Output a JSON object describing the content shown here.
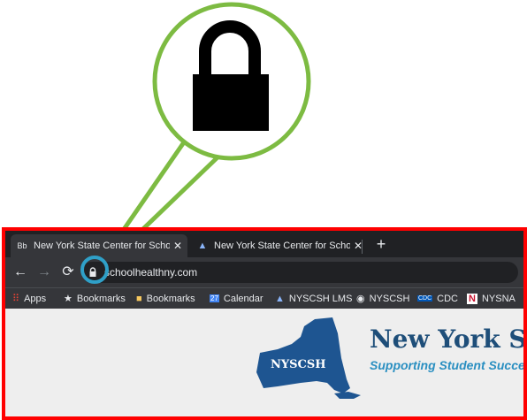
{
  "callout": {
    "icon": "lock-icon",
    "ring_color": "#7dbb42",
    "highlight_color": "#2fa0c8"
  },
  "frame": {
    "border_color": "#ff0000"
  },
  "tabs": [
    {
      "favicon": "Bb",
      "title": "New York State Center for School",
      "close": "✕",
      "active": true
    },
    {
      "favicon": "map-icon",
      "title": "New York State Center for School",
      "close": "✕",
      "active": false
    }
  ],
  "toolbar": {
    "new_tab": "+",
    "back": "←",
    "forward": "→",
    "reload": "⟳",
    "url": "schoolhealthny.com"
  },
  "bookmarks": [
    {
      "label": "Apps",
      "icon": "apps-grid-icon"
    },
    {
      "label": "Bookmarks",
      "icon": "star-icon"
    },
    {
      "label": "Bookmarks",
      "icon": "folder-icon"
    },
    {
      "label": "Calendar",
      "icon": "calendar-icon",
      "icon_text": "27"
    },
    {
      "label": "NYSCSH LMS",
      "icon": "nyscsh-icon"
    },
    {
      "label": "NYSCSH",
      "icon": "globe-icon"
    },
    {
      "label": "CDC",
      "icon": "cdc-icon",
      "icon_text": "CDC"
    },
    {
      "label": "NYSNA",
      "icon": "nysna-icon",
      "icon_text": "N"
    }
  ],
  "page": {
    "map_label": "NYSCSH",
    "title": "New York Sta",
    "tagline": "Supporting Student Succe",
    "title_color": "#1e4e79",
    "tagline_color": "#2a8fc1"
  }
}
